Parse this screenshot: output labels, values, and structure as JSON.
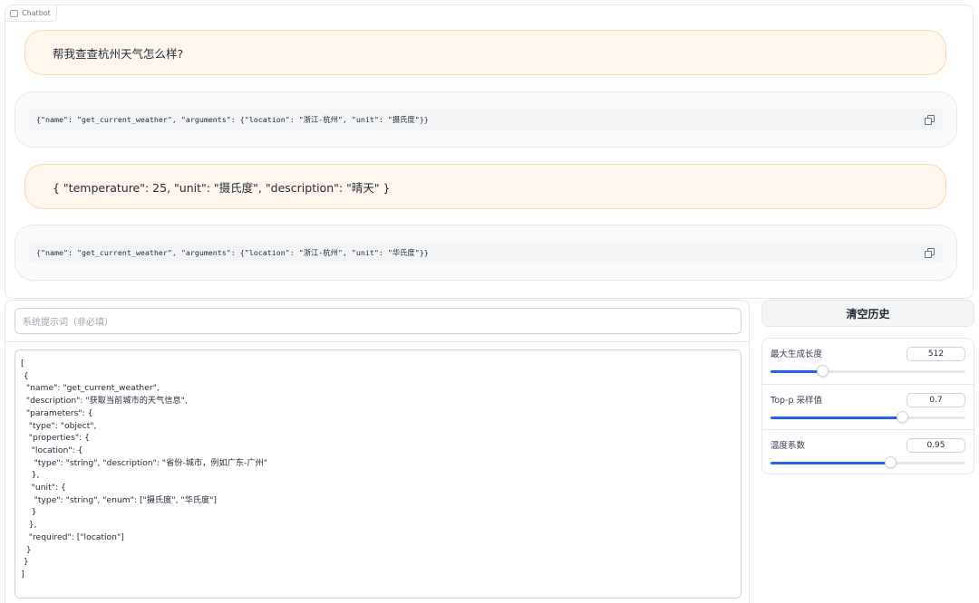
{
  "chatbot": {
    "label": "Chatbot",
    "messages": [
      {
        "role": "user",
        "text": "帮我查查杭州天气怎么样?"
      },
      {
        "role": "assistant",
        "code": "{\"name\": \"get_current_weather\", \"arguments\": {\"location\": \"浙江-杭州\", \"unit\": \"摄氏度\"}}"
      },
      {
        "role": "user",
        "text": "{ \"temperature\": 25, \"unit\": \"摄氏度\", \"description\": \"晴天\" }"
      },
      {
        "role": "assistant",
        "code": "{\"name\": \"get_current_weather\", \"arguments\": {\"location\": \"浙江-杭州\", \"unit\": \"华氏度\"}}"
      }
    ]
  },
  "system_prompt": {
    "placeholder": "系统提示词（非必填）",
    "value": ""
  },
  "tools_text": {
    "lines": [
      "[",
      " {",
      "  \"name\": \"get_current_weather\",",
      "  \"description\": \"获取当前城市的天气信息\",",
      "  \"parameters\": {",
      "   \"type\": \"object\",",
      "   \"properties\": {",
      "    \"location\": {",
      "     \"type\": \"string\", \"description\": \"省份-城市，例如广东-广州\"",
      "    },",
      "    \"unit\": {",
      "     \"type\": \"string\", \"enum\": [\"摄氏度\", \"华氏度\"]",
      "    }",
      "   },",
      "   \"required\": [\"location\"]",
      "  }",
      " }",
      "]"
    ]
  },
  "clear_button": {
    "label": "清空历史"
  },
  "sliders": [
    {
      "label": "最大生成长度",
      "value": "512",
      "fraction": 0.27
    },
    {
      "label": "Top-p 采样值",
      "value": "0.7",
      "fraction": 0.68
    },
    {
      "label": "温度系数",
      "value": "0.95",
      "fraction": 0.62
    }
  ],
  "colors": {
    "user_bubble": "#fff7ed",
    "user_border": "#fed7aa",
    "bot_bubble": "#f9fafb",
    "accent": "#2563eb"
  }
}
